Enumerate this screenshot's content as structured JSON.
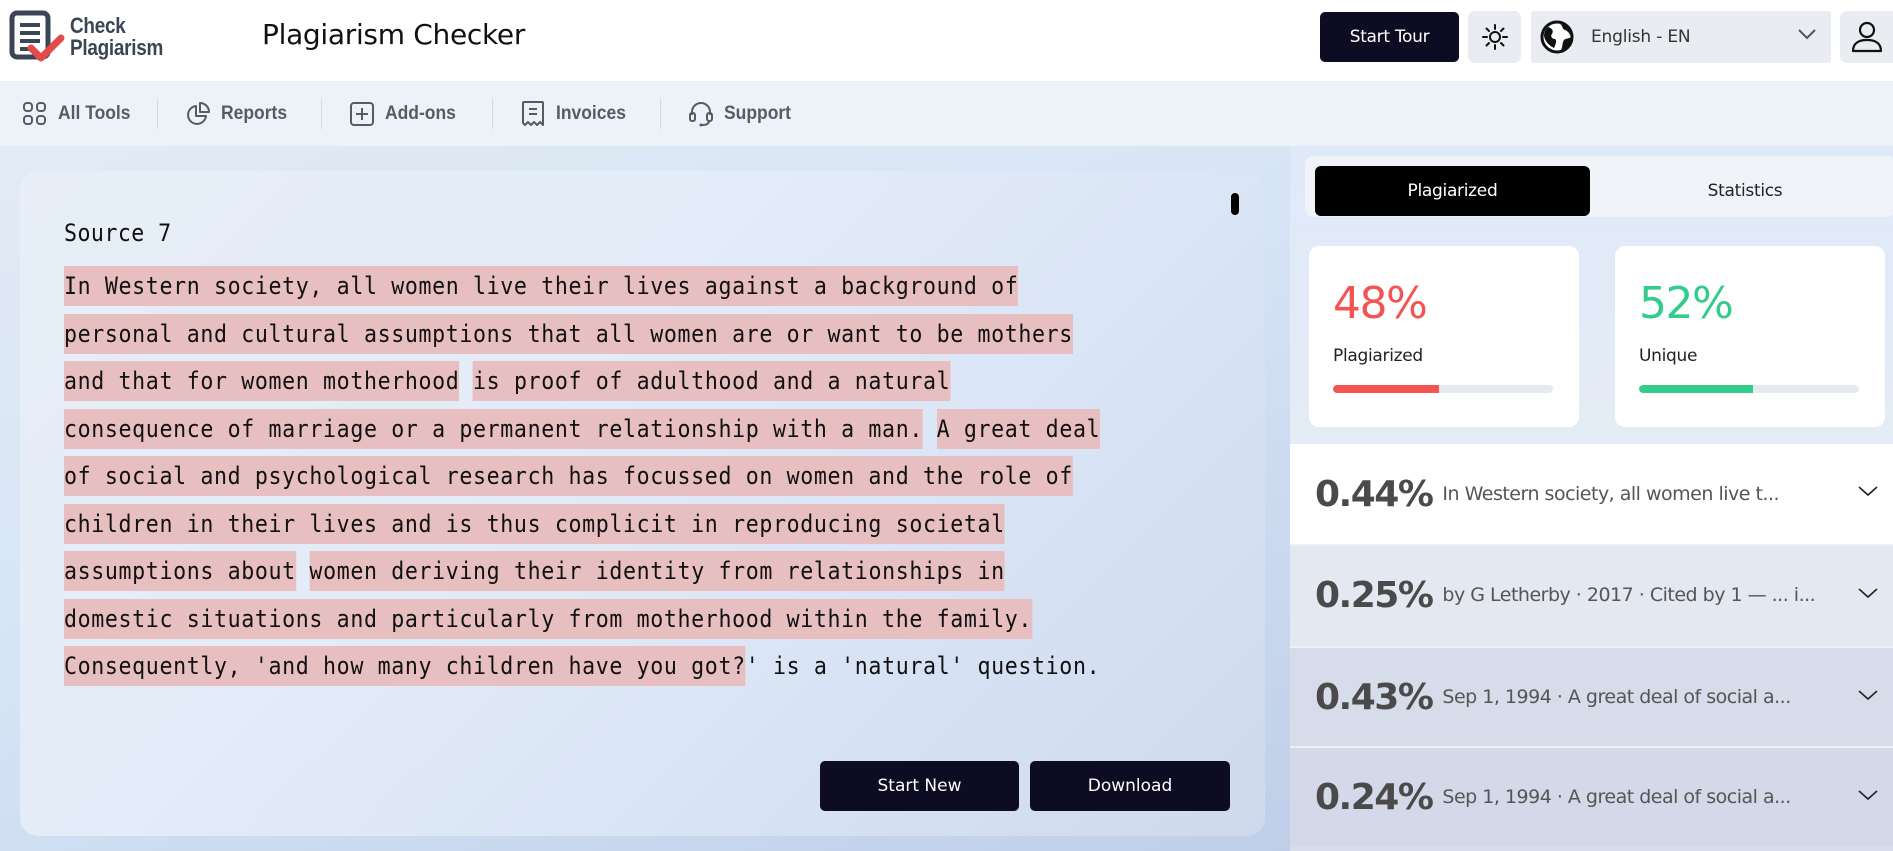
{
  "header": {
    "logo_line1": "Check",
    "logo_line2": "Plagiarism",
    "title": "Plagiarism Checker",
    "start_tour": "Start Tour",
    "theme_icon": "sun-icon",
    "language": "English - EN",
    "user_icon": "user-icon"
  },
  "nav": {
    "items": [
      {
        "label": "All Tools",
        "icon": "grid-icon"
      },
      {
        "label": "Reports",
        "icon": "pie-chart-icon"
      },
      {
        "label": "Add-ons",
        "icon": "plus-square-icon"
      },
      {
        "label": "Invoices",
        "icon": "receipt-icon"
      },
      {
        "label": "Support",
        "icon": "headset-icon"
      }
    ]
  },
  "editor": {
    "source_title": "Source 7",
    "lines": [
      [
        {
          "t": "In Western society, all women live their lives against a background of",
          "h": true
        }
      ],
      [
        {
          "t": "personal and cultural assumptions that all women are or want to be mothers",
          "h": true
        }
      ],
      [
        {
          "t": "and that for women motherhood",
          "h": true
        },
        {
          "t": " ",
          "h": false
        },
        {
          "t": "is proof of adulthood and a natural",
          "h": true
        }
      ],
      [
        {
          "t": "consequence of marriage or a permanent relationship with a man.",
          "h": true
        },
        {
          "t": " ",
          "h": false
        },
        {
          "t": "A great deal",
          "h": true
        }
      ],
      [
        {
          "t": "of social and psychological research has focussed on women and the role of",
          "h": true
        }
      ],
      [
        {
          "t": "children in their lives and is thus complicit in reproducing societal",
          "h": true
        }
      ],
      [
        {
          "t": "assumptions about",
          "h": true
        },
        {
          "t": " ",
          "h": false
        },
        {
          "t": "women deriving their identity from relationships in",
          "h": true
        }
      ],
      [
        {
          "t": "domestic situations and particularly from motherhood within the family.",
          "h": true
        }
      ],
      [
        {
          "t": "Consequently, 'and how many children have you got?",
          "h": true
        },
        {
          "t": "' is a 'natural' question.",
          "h": false
        }
      ]
    ],
    "start_new": "Start New",
    "download": "Download"
  },
  "side": {
    "tabs": [
      {
        "label": "Plagiarized",
        "active": true
      },
      {
        "label": "Statistics",
        "active": false
      }
    ],
    "stats": [
      {
        "value": "48%",
        "label": "Plagiarized",
        "fraction": 0.48,
        "color": "#f25551"
      },
      {
        "value": "52%",
        "label": "Unique",
        "fraction": 0.52,
        "color": "#33cc8a"
      }
    ],
    "results": [
      {
        "pct": "0.44%",
        "text": "In Western society, all women live t...",
        "bg": "#ffffff"
      },
      {
        "pct": "0.25%",
        "text": "by G Letherby · 2017 · Cited by 1 — ... i...",
        "bg": "#e4e8f1"
      },
      {
        "pct": "0.43%",
        "text": "Sep 1, 1994 · A great deal of social a...",
        "bg": "#d6dce9"
      },
      {
        "pct": "0.24%",
        "text": "Sep 1, 1994 · A great deal of social a...",
        "bg": "#d3d9e8"
      }
    ]
  }
}
